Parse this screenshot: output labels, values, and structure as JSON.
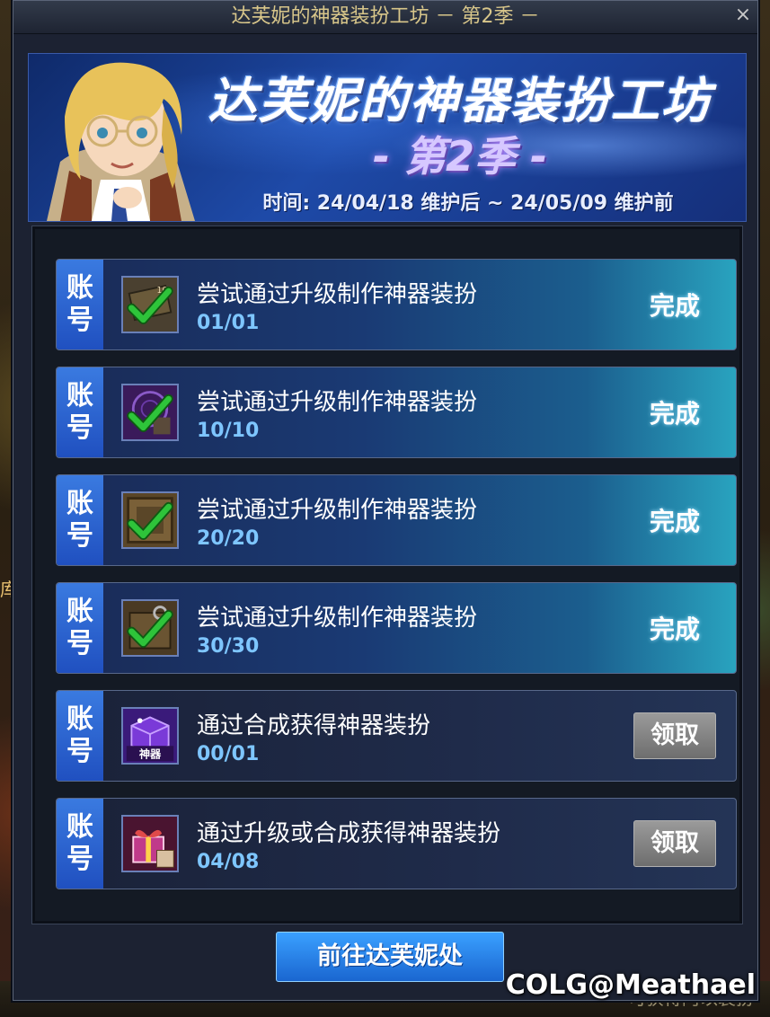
{
  "window": {
    "title": "达芙妮的神器装扮工坊 － 第2季 －",
    "close_symbol": "×"
  },
  "banner": {
    "title": "达芙妮的神器装扮工坊",
    "season": "- 第2季 -",
    "time": "时间: 24/04/18 维护后 ~ 24/05/09 维护前"
  },
  "background": {
    "side_text": "库",
    "bottom_text": "可获得阿以装扮"
  },
  "tasks": [
    {
      "tag_line1": "账",
      "tag_line2": "号",
      "title": "尝试通过升级制作神器装扮",
      "progress": "01/01",
      "state": "完成",
      "icon": "ticket-check-icon"
    },
    {
      "tag_line1": "账",
      "tag_line2": "号",
      "title": "尝试通过升级制作神器装扮",
      "progress": "10/10",
      "state": "完成",
      "icon": "purple-box-check-icon"
    },
    {
      "tag_line1": "账",
      "tag_line2": "号",
      "title": "尝试通过升级制作神器装扮",
      "progress": "20/20",
      "state": "完成",
      "icon": "bronze-box-check-icon"
    },
    {
      "tag_line1": "账",
      "tag_line2": "号",
      "title": "尝试通过升级制作神器装扮",
      "progress": "30/30",
      "state": "完成",
      "icon": "ring-box-check-icon"
    },
    {
      "tag_line1": "账",
      "tag_line2": "号",
      "title": "通过合成获得神器装扮",
      "progress": "00/01",
      "button": "领取",
      "icon": "artifact-box-icon",
      "icon_text": "神器"
    },
    {
      "tag_line1": "账",
      "tag_line2": "号",
      "title": "通过升级或合成获得神器装扮",
      "progress": "04/08",
      "button": "领取",
      "icon": "gift-box-icon"
    }
  ],
  "footer": {
    "goto_label": "前往达芙妮处"
  },
  "watermark": "COLG@Meathael",
  "colors": {
    "accent_blue": "#1a66d0",
    "progress_text": "#7ec6ff",
    "check_green": "#2ec43a"
  }
}
